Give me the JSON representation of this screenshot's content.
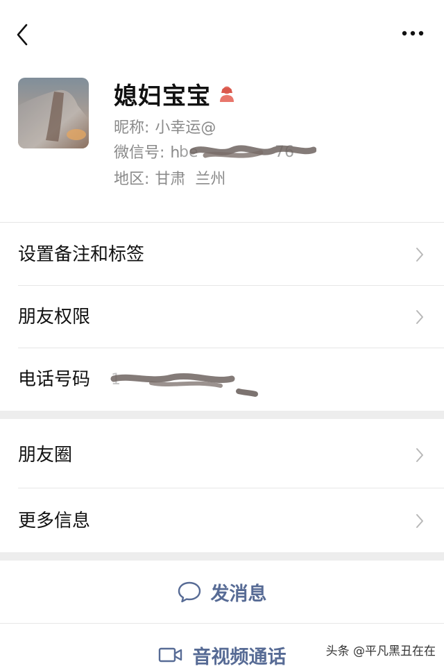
{
  "colors": {
    "link": "#576b95",
    "gender": "#e8766b",
    "meta_text": "#8a8a8a",
    "gap": "#ededed"
  },
  "topbar": {
    "back_icon": "chevron-left-icon",
    "more_icon": "more-dots-icon"
  },
  "profile": {
    "name": "媳妇宝宝",
    "gender_icon": "female-icon",
    "nickname_label": "昵称:",
    "nickname_value": "小幸运@",
    "wechat_id_label": "微信号:",
    "wechat_id_value": "h",
    "region_label": "地区:",
    "region_value": "甘肃  兰州"
  },
  "menu": {
    "remark_tags": "设置备注和标签",
    "friend_permissions": "朋友权限",
    "phone_label": "电话号码",
    "moments": "朋友圈",
    "more_info": "更多信息"
  },
  "actions": {
    "message_label": "发消息",
    "message_icon": "chat-bubble-icon",
    "call_label": "音视频通话",
    "call_icon": "video-camera-icon"
  },
  "watermark": "头条 @平凡黑丑在在"
}
